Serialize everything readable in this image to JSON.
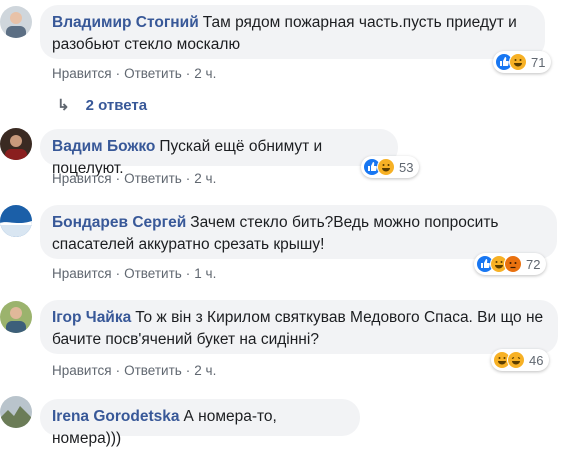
{
  "comments": [
    {
      "author": "Владимир Стогний",
      "text": "Там рядом пожарная часть.пусть приедут и разобьют стекло москалю",
      "like_label": "Нравится",
      "reply_label": "Ответить",
      "time": "2 ч.",
      "reactions": {
        "icons": [
          "like-icon",
          "haha-icon"
        ],
        "count": "71"
      }
    },
    {
      "author": "Вадим Божко",
      "text": "Пускай ещё обнимут и поцелуют.",
      "like_label": "Нравится",
      "reply_label": "Ответить",
      "time": "2 ч.",
      "reactions": {
        "icons": [
          "like-icon",
          "haha-icon"
        ],
        "count": "53"
      }
    },
    {
      "author": "Бондарев Сергей",
      "text": "Зачем стекло бить?Ведь можно попросить спасателей аккуратно срезать крышу!",
      "like_label": "Нравится",
      "reply_label": "Ответить",
      "time": "1 ч.",
      "reactions": {
        "icons": [
          "like-icon",
          "haha-icon",
          "angry-icon"
        ],
        "count": "72"
      }
    },
    {
      "author": "Ігор Чайка",
      "text": "То ж він з Кирилом святкував Медового Спаса. Ви що не бачите посв'ячений букет на сидінні?",
      "like_label": "Нравится",
      "reply_label": "Ответить",
      "time": "2 ч.",
      "reactions": {
        "icons": [
          "haha-icon",
          "laugh-icon"
        ],
        "count": "46"
      }
    },
    {
      "author": "Irena Gorodetska",
      "text": "А номера-то, номера)))"
    }
  ],
  "replies_link": "2 ответа",
  "separator": "·",
  "colors": {
    "author": "#385898",
    "meta": "#606770",
    "bubble": "#f2f3f5",
    "like": "#1877f2",
    "haha": "#f7b125",
    "angry": "#e9710f"
  }
}
